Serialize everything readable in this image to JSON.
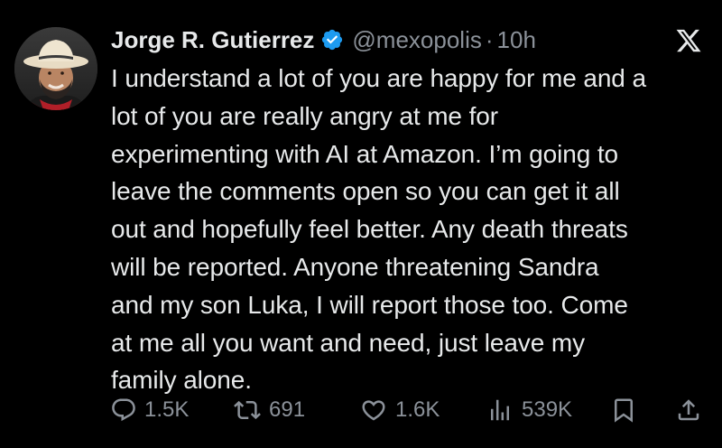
{
  "tweet": {
    "author_name": "Jorge R. Gutierrez",
    "handle": "@mexopolis",
    "separator": "·",
    "time": "10h",
    "verified": true,
    "body_lines": [
      "I understand a lot of you are happy for me and a",
      "lot of you are really angry at me for",
      "experimenting with AI at Amazon. I’m going to",
      "leave the comments open so you can get it all",
      "out and hopefully feel better. Any death threats",
      "will be reported. Anyone threatening Sandra",
      "and my son Luka, I will report those too. Come",
      "at me all you want and need, just leave my",
      "family alone."
    ]
  },
  "actions": {
    "reply_count": "1.5K",
    "repost_count": "691",
    "like_count": "1.6K",
    "view_count": "539K"
  },
  "icons": {
    "verified": "verified-badge-icon",
    "platform": "x-logo-icon",
    "reply": "reply-icon",
    "repost": "repost-icon",
    "like": "heart-icon",
    "views": "views-icon",
    "bookmark": "bookmark-icon",
    "share": "share-icon"
  },
  "colors": {
    "background": "#000000",
    "text": "#e7e9ea",
    "secondary_text": "#8b9199",
    "verified_blue": "#1d9bf0"
  }
}
